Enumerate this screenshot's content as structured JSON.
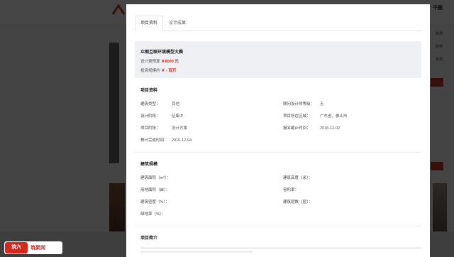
{
  "background": {
    "brand_right": "千图",
    "side_labels": [
      "数据",
      "数据",
      "数据"
    ]
  },
  "tabs": [
    {
      "label": "项目资料",
      "active": true
    },
    {
      "label": "设计成果",
      "active": false
    }
  ],
  "summary": {
    "title": "众图互联环境模型大赛",
    "budget_label": "设计费预算",
    "budget_value": "￥8000 元",
    "invest_label": "投资规模约",
    "invest_value": "￥ - 百万"
  },
  "project_info": {
    "title": "项目资料",
    "fields": [
      {
        "key": "建筑类型：",
        "value": "其他"
      },
      {
        "key": "顾问设计师等级：",
        "value": "无"
      },
      {
        "key": "设计阶段：",
        "value": "征集中"
      },
      {
        "key": "项目所在区域：",
        "value": "广东省，佛山市"
      },
      {
        "key": "项目阶段：",
        "value": "设计方案"
      },
      {
        "key": "报名截止时间：",
        "value": "2016-12-02"
      },
      {
        "key": "预计完成时间：",
        "value": "2016-12-04"
      }
    ]
  },
  "building_scale": {
    "title": "建筑规模",
    "fields": [
      {
        "key": "建筑面积（m²）：",
        "value": ""
      },
      {
        "key": "建筑高度（米）：",
        "value": ""
      },
      {
        "key": "用地面积（亩）：",
        "value": ""
      },
      {
        "key": "容积率：",
        "value": ""
      },
      {
        "key": "建筑密度（%）：",
        "value": ""
      },
      {
        "key": "建筑层数（层）：",
        "value": ""
      },
      {
        "key": "绿地率（%）：",
        "value": ""
      }
    ]
  },
  "project_intro": {
    "title": "项目简介"
  },
  "badge": {
    "mark": "筑六",
    "text": "筑聚网"
  },
  "colors": {
    "accent": "#d9261c",
    "summary_bg": "#eef0f3",
    "overlay": "rgba(0,0,0,0.72)"
  }
}
